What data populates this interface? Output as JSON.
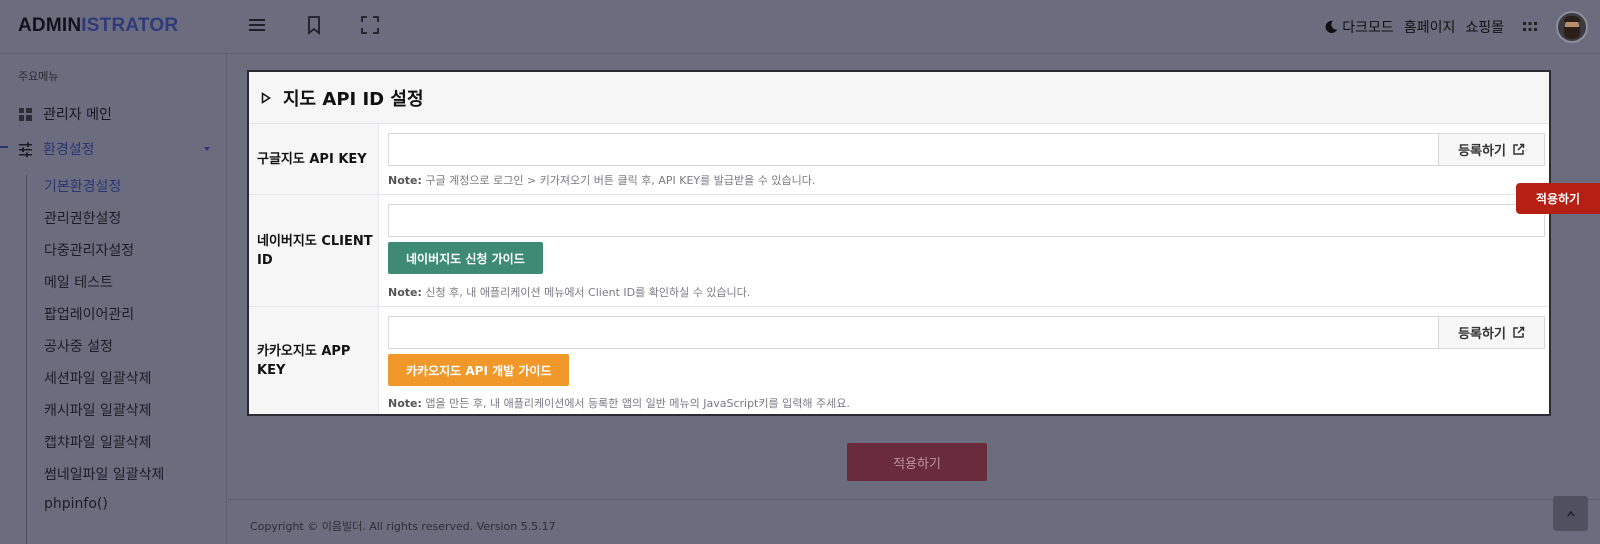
{
  "header": {
    "logo_part1": "ADMIN",
    "logo_part2": "ISTRATOR",
    "right_links": [
      "다크모드",
      "홈페이지",
      "쇼핑몰"
    ]
  },
  "sidebar": {
    "heading": "주요메뉴",
    "items": [
      {
        "label": "관리자 메인",
        "icon": "grid-icon"
      },
      {
        "label": "환경설정",
        "icon": "sliders-icon"
      }
    ],
    "sub_items": [
      "기본환경설정",
      "관리권한설정",
      "다중관리자설정",
      "메일 테스트",
      "팝업레이어관리",
      "공사중 설정",
      "세션파일 일괄삭제",
      "캐시파일 일괄삭제",
      "캡챠파일 일괄삭제",
      "썸네일파일 일괄삭제",
      "phpinfo()"
    ]
  },
  "panel": {
    "title": "지도 API ID 설정",
    "rows": [
      {
        "label": "구글지도 API KEY",
        "input_value": "",
        "button": "등록하기",
        "note_prefix": "Note:",
        "note": "구글 계정으로 로그인 > 키가져오기 버튼 클릭 후, API KEY를 발급받을 수 있습니다."
      },
      {
        "label": "네이버지도 CLIENT ID",
        "input_value": "",
        "guide_button": "네이버지도 신청 가이드",
        "note_prefix": "Note:",
        "note": "신청 후, 내 애플리케이션 메뉴에서 Client ID를 확인하실 수 있습니다."
      },
      {
        "label": "카카오지도 APP KEY",
        "input_value": "",
        "button": "등록하기",
        "guide_button": "카카오지도 API 개발 가이드",
        "note_prefix": "Note:",
        "note": "앱을 만든 후, 내 애플리케이션에서 등록한 앱의 일반 메뉴의 JavaScript키를 입력해 주세요."
      }
    ]
  },
  "float_apply": "적용하기",
  "apply_button": "적용하기",
  "footer": "Copyright © 이음빌더. All rights reserved. Version 5.5.17",
  "colors": {
    "green_guide": "#3e8a74",
    "orange_guide": "#f0982a",
    "apply_red": "#b51f14",
    "brand_blue": "#2f3a7a"
  }
}
